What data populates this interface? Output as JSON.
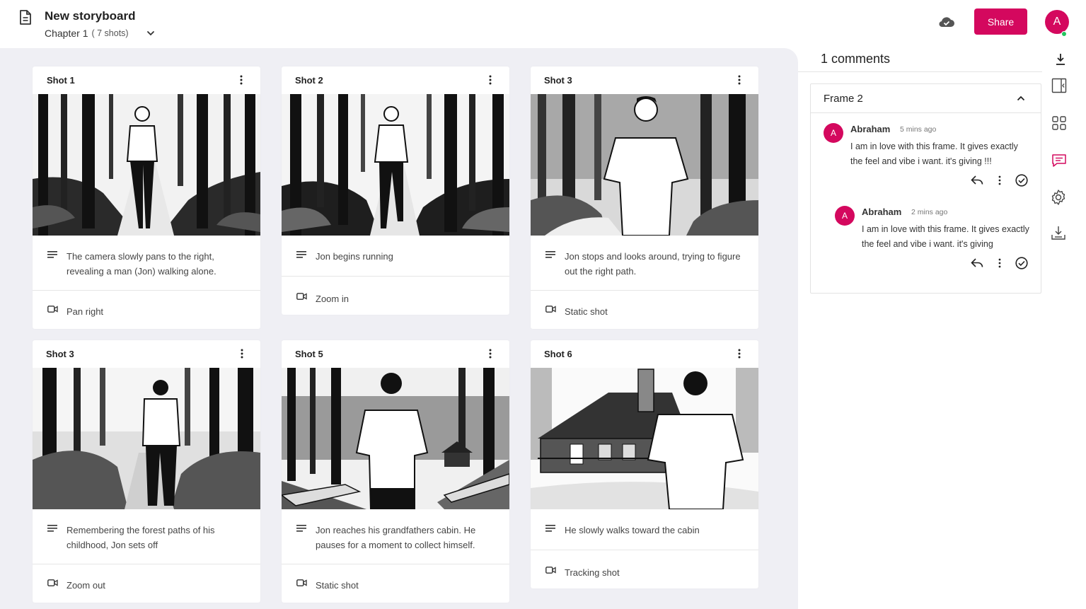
{
  "header": {
    "title": "New storyboard",
    "chapter": "Chapter 1",
    "shot_count": "( 7 shots)",
    "share_label": "Share",
    "avatar_initial": "A",
    "accent_color": "#d4085e"
  },
  "shots": [
    {
      "title": "Shot 1",
      "description": "The camera slowly pans to the right, revealing a man (Jon) walking alone.",
      "camera": "Pan right"
    },
    {
      "title": "Shot 2",
      "description": "Jon begins running",
      "camera": "Zoom in"
    },
    {
      "title": "Shot 3",
      "description": "Jon stops and looks around, trying to figure out the right path.",
      "camera": "Static shot"
    },
    {
      "title": "Shot 3",
      "description": "Remembering the forest paths of his childhood, Jon sets off",
      "camera": "Zoom out"
    },
    {
      "title": "Shot 5",
      "description": "Jon reaches his grandfathers cabin. He pauses for a moment to collect himself.",
      "camera": "Static shot"
    },
    {
      "title": "Shot 6",
      "description": "He slowly walks toward the cabin",
      "camera": "Tracking shot"
    }
  ],
  "comments_panel": {
    "title": "1 comments",
    "frame_label": "Frame 2",
    "comments": [
      {
        "initial": "A",
        "author": "Abraham",
        "time": "5 mins ago",
        "text": "I am in love with this frame. It gives exactly the feel and vibe i want. it's giving !!!"
      },
      {
        "initial": "A",
        "author": "Abraham",
        "time": "2 mins ago",
        "text": "I am in love with this frame. It gives exactly the feel and vibe i want. it's giving"
      }
    ]
  },
  "icons": [
    "document-icon",
    "chevron-down-icon",
    "cloud-check-icon",
    "kebab-menu-icon",
    "text-lines-icon",
    "camera-icon",
    "download-icon",
    "chevron-up-icon",
    "reply-icon",
    "check-circle-icon",
    "collapse-panel-icon",
    "grid-icon",
    "comment-icon",
    "settings-icon",
    "import-icon"
  ]
}
